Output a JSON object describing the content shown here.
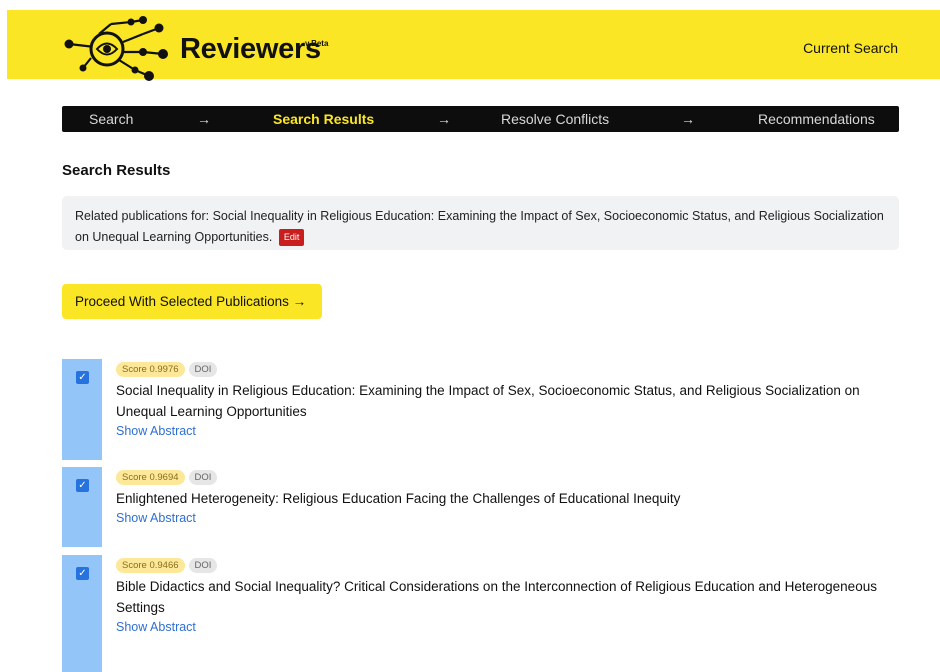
{
  "header": {
    "brand": "Reviewers",
    "version": "v.Beta",
    "current_search": "Current Search",
    "background": "#fbe625"
  },
  "stepper": {
    "steps": [
      {
        "label": "Search",
        "active": false
      },
      {
        "label": "Search Results",
        "active": true
      },
      {
        "label": "Resolve Conflicts",
        "active": false
      },
      {
        "label": "Recommendations",
        "active": false
      }
    ],
    "separator": "→"
  },
  "page_title": "Search Results",
  "query": {
    "prefix": "Related publications for:",
    "text": "Social Inequality in Religious Education: Examining the Impact of Sex, Socioeconomic Status, and Religious Socialization on Unequal Learning Opportunities.",
    "edit_label": "Edit"
  },
  "proceed_button": "Proceed With Selected Publications →",
  "publications": [
    {
      "score": "Score 0.9976",
      "doi": "DOI",
      "title": "Social Inequality in Religious Education: Examining the Impact of Sex, Socioeconomic Status, and Religious Socialization on Unequal Learning Opportunities",
      "show_abstract": "Show Abstract",
      "selected": true
    },
    {
      "score": "Score 0.9694",
      "doi": "DOI",
      "title": "Enlightened Heterogeneity: Religious Education Facing the Challenges of Educational Inequity",
      "show_abstract": "Show Abstract",
      "selected": true
    },
    {
      "score": "Score 0.9466",
      "doi": "DOI",
      "title": "Bible Didactics and Social Inequality? Critical Considerations on the Interconnection of Religious Education and Heterogeneous Settings",
      "show_abstract": "Show Abstract",
      "selected": true
    }
  ],
  "colors": {
    "accent": "#fbe625",
    "selected_row": "#93c5f8",
    "edit_button": "#c81e1e",
    "link": "#2f6fd1"
  }
}
